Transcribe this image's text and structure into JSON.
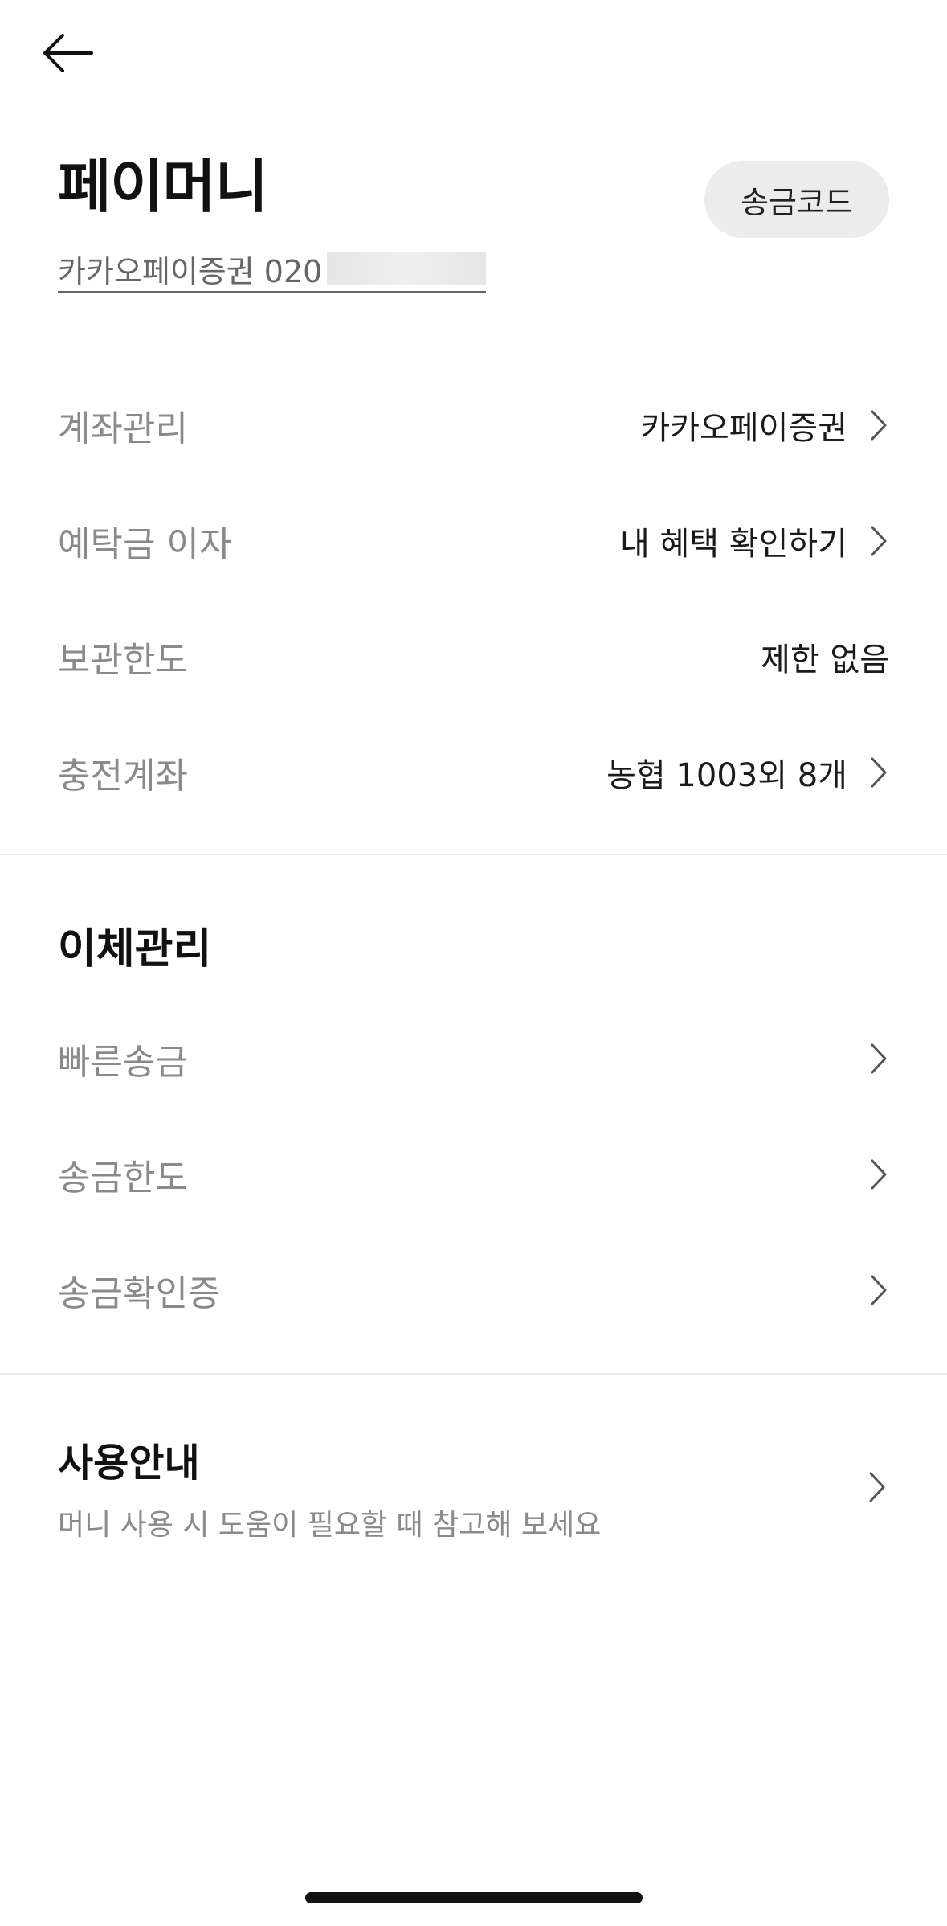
{
  "header": {
    "title": "페이머니",
    "account_label": "카카오페이증권 020",
    "send_code_label": "송금코드"
  },
  "info_rows": [
    {
      "label": "계좌관리",
      "value": "카카오페이증권",
      "has_chevron": true
    },
    {
      "label": "예탁금 이자",
      "value": "내 혜택 확인하기",
      "has_chevron": true
    },
    {
      "label": "보관한도",
      "value": "제한 없음",
      "has_chevron": false
    },
    {
      "label": "충전계좌",
      "value": "농협 1003외 8개",
      "has_chevron": true
    }
  ],
  "transfer_section": {
    "title": "이체관리",
    "items": [
      {
        "label": "빠른송금"
      },
      {
        "label": "송금한도"
      },
      {
        "label": "송금확인증"
      }
    ]
  },
  "guide": {
    "title": "사용안내",
    "subtitle": "머니 사용 시 도움이 필요할 때 참고해 보세요"
  },
  "icons": {
    "back": "arrow-left-icon",
    "chevron": "chevron-right-icon"
  }
}
